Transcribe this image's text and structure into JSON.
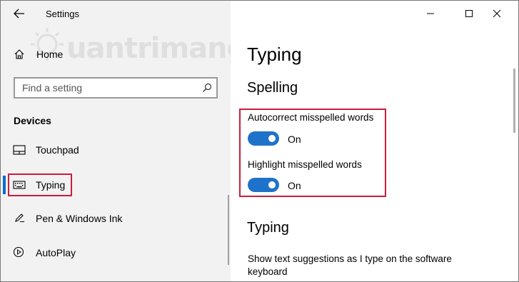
{
  "window": {
    "title": "Settings",
    "controls": [
      "minimize-icon",
      "maximize-icon",
      "close-icon"
    ]
  },
  "sidebar": {
    "home_label": "Home",
    "search_placeholder": "Find a setting",
    "section_label": "Devices",
    "items": [
      {
        "label": "Touchpad",
        "icon": "touchpad-icon",
        "selected": false
      },
      {
        "label": "Typing",
        "icon": "keyboard-icon",
        "selected": true
      },
      {
        "label": "Pen & Windows Ink",
        "icon": "pen-icon",
        "selected": false
      },
      {
        "label": "AutoPlay",
        "icon": "autoplay-icon",
        "selected": false
      }
    ]
  },
  "watermark": "uantrimang",
  "main": {
    "page_title": "Typing",
    "spelling": {
      "title": "Spelling",
      "settings": [
        {
          "label": "Autocorrect misspelled words",
          "state": "On",
          "on": true
        },
        {
          "label": "Highlight misspelled words",
          "state": "On",
          "on": true
        }
      ]
    },
    "typing": {
      "title": "Typing",
      "description": "Show text suggestions as I type on the software keyboard"
    }
  },
  "colors": {
    "accent": "#0a6cd6",
    "toggle_on": "#1f72c9",
    "highlight": "#c81e3c",
    "sidebar_bg": "#f2f2f2"
  }
}
